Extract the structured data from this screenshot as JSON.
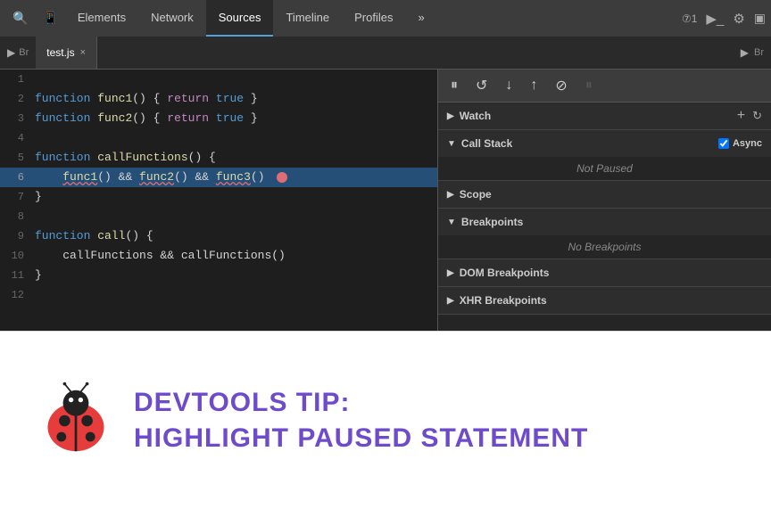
{
  "toolbar": {
    "search_icon": "🔍",
    "mobile_icon": "📱",
    "tabs": [
      {
        "label": "Elements",
        "active": false
      },
      {
        "label": "Network",
        "active": false
      },
      {
        "label": "Sources",
        "active": true
      },
      {
        "label": "Timeline",
        "active": false
      },
      {
        "label": "Profiles",
        "active": false
      },
      {
        "label": "»",
        "active": false
      }
    ],
    "right": {
      "counter": "⑦1",
      "terminal": ">_",
      "settings": "⚙",
      "dock": "▣"
    }
  },
  "file_tab": {
    "play_icon": "▶",
    "br_icon": "Br",
    "filename": "test.js",
    "close": "×",
    "right_icons": [
      "▶",
      "Br"
    ]
  },
  "debug_toolbar": {
    "pause": "⏸",
    "step_over": "↺",
    "step_into": "↓",
    "step_out": "↑",
    "deactivate": "⊘",
    "pause_on_exception": "⏸"
  },
  "code": {
    "lines": [
      {
        "num": 1,
        "content": ""
      },
      {
        "num": 2,
        "content": "function func1() { return true }"
      },
      {
        "num": 3,
        "content": "function func2() { return true }"
      },
      {
        "num": 4,
        "content": ""
      },
      {
        "num": 5,
        "content": "function callFunctions() {"
      },
      {
        "num": 6,
        "content": "    func1() && func2() && func3()",
        "highlight": true,
        "error": true
      },
      {
        "num": 7,
        "content": "}"
      },
      {
        "num": 8,
        "content": ""
      },
      {
        "num": 9,
        "content": "function call() {"
      },
      {
        "num": 10,
        "content": "    callFunctions && callFunctions()"
      },
      {
        "num": 11,
        "content": "}"
      },
      {
        "num": 12,
        "content": ""
      }
    ]
  },
  "panels": {
    "watch": {
      "label": "Watch",
      "expanded": true,
      "add_btn": "+",
      "refresh_btn": "↻"
    },
    "call_stack": {
      "label": "Call Stack",
      "expanded": true,
      "async_label": "Async",
      "status": "Not Paused"
    },
    "scope": {
      "label": "Scope",
      "expanded": false
    },
    "breakpoints": {
      "label": "Breakpoints",
      "expanded": true,
      "status": "No Breakpoints"
    },
    "dom_breakpoints": {
      "label": "DOM Breakpoints",
      "expanded": false
    },
    "xhr_breakpoints": {
      "label": "XHR Breakpoints",
      "expanded": false
    }
  },
  "tip": {
    "label": "DevTools Tip:",
    "title": "Highlight Paused Statement"
  }
}
